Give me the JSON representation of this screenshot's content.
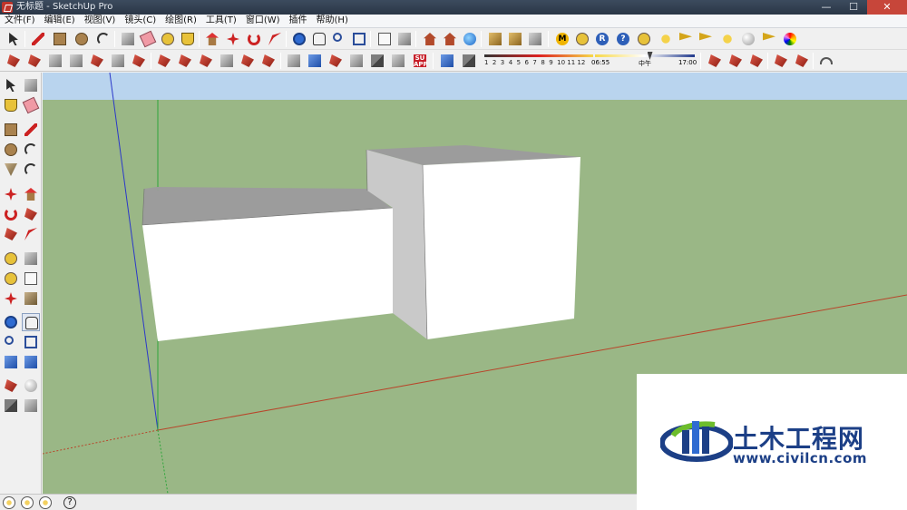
{
  "window": {
    "title": "无标题 - SketchUp Pro",
    "minimize": "—",
    "maximize": "☐",
    "close": "✕"
  },
  "menu": [
    {
      "label": "文件(F)"
    },
    {
      "label": "编辑(E)"
    },
    {
      "label": "视图(V)"
    },
    {
      "label": "镜头(C)"
    },
    {
      "label": "绘图(R)"
    },
    {
      "label": "工具(T)"
    },
    {
      "label": "窗口(W)"
    },
    {
      "label": "插件"
    },
    {
      "label": "帮助(H)"
    }
  ],
  "toolbar": {
    "su_app_top": "SU",
    "su_app_bottom": "APP",
    "letter_M": "M",
    "letter_R": "R",
    "help_mark": "?"
  },
  "shadows": {
    "months": "1  2  3  4  5  6  7  8  9  10 11 12",
    "time_start": "06:55",
    "time_mid": "中午",
    "time_end": "17:00",
    "time_fraction": 0.55
  },
  "statusbar": {
    "help": "?"
  },
  "watermark": {
    "title": "土木工程网",
    "url": "www.civilcn.com"
  },
  "colors": {
    "sky": "#b9d4ee",
    "ground": "#9ab786",
    "face_lit": "#ffffff",
    "face_shade": "#bdbdbd",
    "roof": "#9c9c9c",
    "axis_red": "#b8452a",
    "axis_green": "#2da63a",
    "axis_blue": "#2b38c9",
    "brand_blue": "#1c3f86"
  }
}
